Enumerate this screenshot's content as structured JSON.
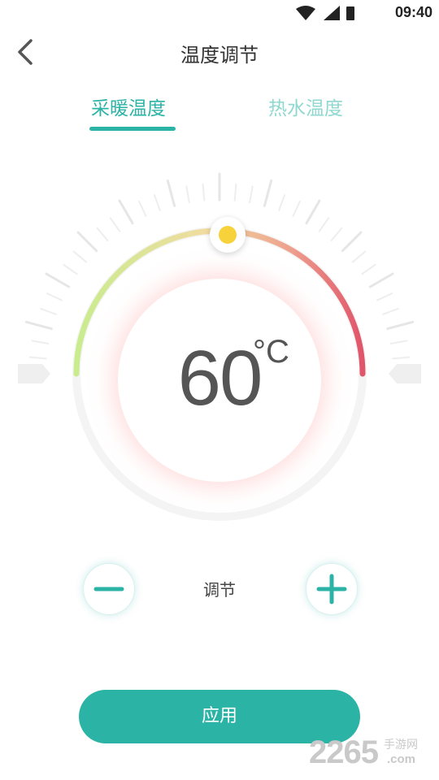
{
  "status_bar": {
    "time": "09:40"
  },
  "header": {
    "title": "温度调节"
  },
  "tabs": [
    {
      "label": "采暖温度",
      "active": true
    },
    {
      "label": "热水温度",
      "active": false
    }
  ],
  "dial": {
    "value": "60",
    "unit": "°C",
    "level_fraction": 0.5
  },
  "adjust": {
    "label": "调节",
    "minus_icon": "minus-icon",
    "plus_icon": "plus-icon"
  },
  "apply": {
    "label": "应用"
  },
  "watermark": {
    "number": "2265",
    "site_cn": "手游网",
    "domain": ".com"
  },
  "colors": {
    "accent": "#2bb3a6",
    "tab_inactive": "#8fd8d0",
    "arc_start": "#c9ec8e",
    "arc_end": "#e0556a",
    "knob": "#f7d23a"
  }
}
